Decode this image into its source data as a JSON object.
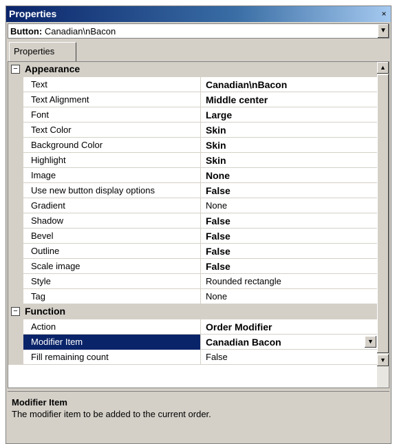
{
  "window": {
    "title": "Properties",
    "close_glyph": "×"
  },
  "object_selector": {
    "type_label": "Button:",
    "object_name": "Canadian\\nBacon"
  },
  "tab": {
    "label": "Properties"
  },
  "categories": {
    "appearance": {
      "toggle": "⊟",
      "label": "Appearance"
    },
    "function": {
      "toggle": "⊟",
      "label": "Function"
    }
  },
  "appearance_props": [
    {
      "name": "Text",
      "value": "Canadian\\nBacon"
    },
    {
      "name": "Text Alignment",
      "value": "Middle center"
    },
    {
      "name": "Font",
      "value": "Large"
    },
    {
      "name": "Text Color",
      "value": "Skin"
    },
    {
      "name": "Background Color",
      "value": "Skin"
    },
    {
      "name": "Highlight",
      "value": "Skin"
    },
    {
      "name": "Image",
      "value": "None"
    },
    {
      "name": "Use new button display options",
      "value": "False"
    },
    {
      "name": "Gradient",
      "value": "None"
    },
    {
      "name": "Shadow",
      "value": "False"
    },
    {
      "name": "Bevel",
      "value": "False"
    },
    {
      "name": "Outline",
      "value": "False"
    },
    {
      "name": "Scale image",
      "value": "False"
    },
    {
      "name": "Style",
      "value": "Rounded rectangle"
    },
    {
      "name": "Tag",
      "value": "None"
    }
  ],
  "function_props": [
    {
      "name": "Action",
      "value": "Order Modifier"
    },
    {
      "name": "Modifier Item",
      "value": "Canadian Bacon"
    },
    {
      "name": "Fill remaining count",
      "value": "False"
    }
  ],
  "description": {
    "title": "Modifier Item",
    "text": "The modifier item to be added to the current order."
  }
}
